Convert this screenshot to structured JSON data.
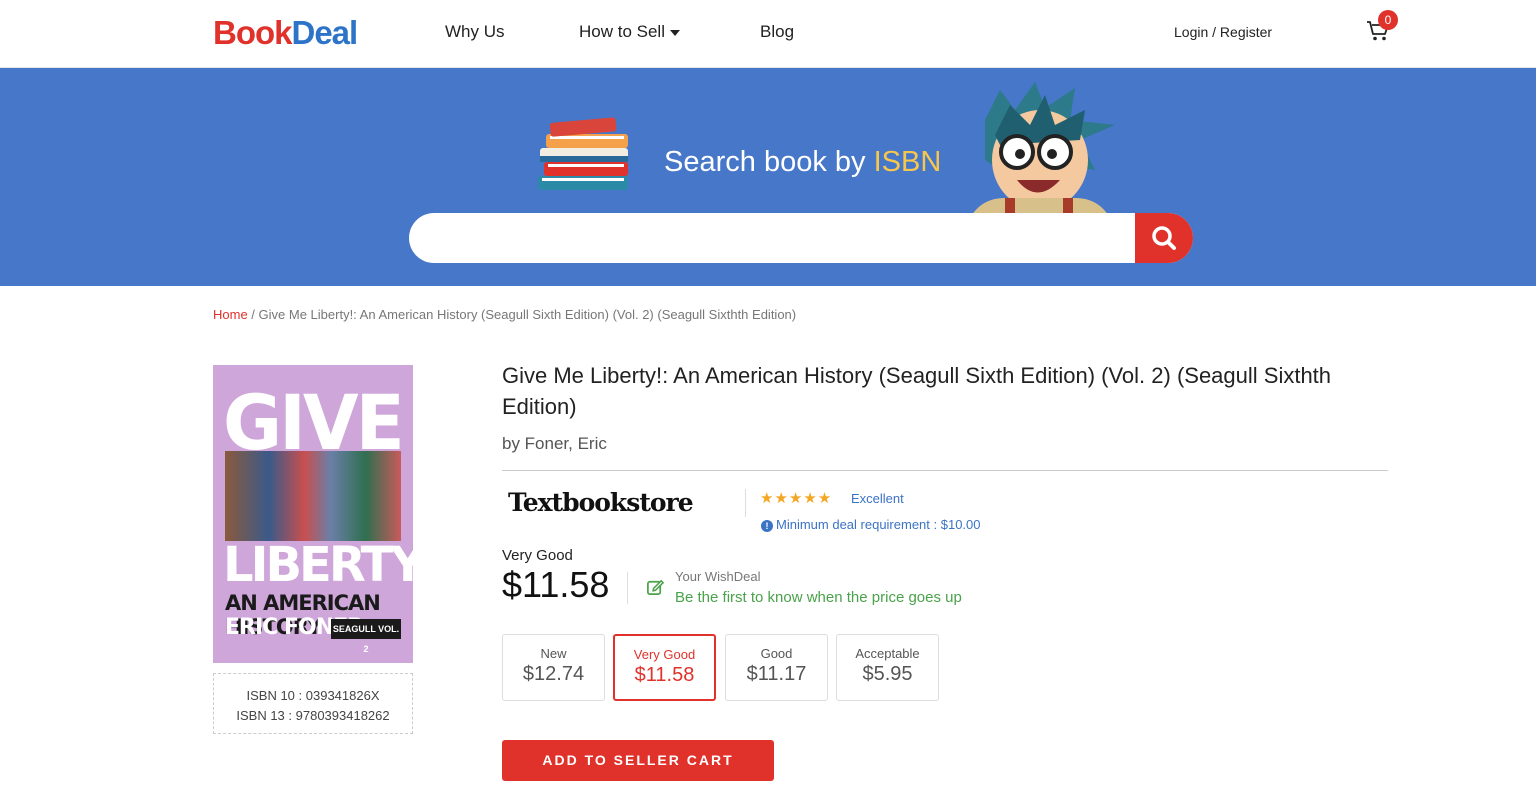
{
  "header": {
    "logo_part1": "Book",
    "logo_part2": "Deal",
    "nav": [
      "Why Us",
      "How to Sell",
      "Blog"
    ],
    "login": "Login / Register",
    "cart_count": "0"
  },
  "hero": {
    "title_part1": "Search book by ",
    "title_part2": "ISBN",
    "search_value": "",
    "search_placeholder": ""
  },
  "breadcrumb": {
    "home": "Home",
    "separator": " / ",
    "current": "Give Me Liberty!: An American History (Seagull Sixth Edition) (Vol. 2) (Seagull Sixthth Edition)"
  },
  "cover": {
    "line1": "GIVE",
    "line2": "LIBERTY!",
    "line3": "AN AMERICAN HISTORY",
    "line4": "ERIC FONER",
    "badge": "SEAGULL VOL. 2"
  },
  "book": {
    "title": "Give Me Liberty!: An American History (Seagull Sixth Edition) (Vol. 2) (Seagull Sixthth Edition)",
    "author": "by Foner, Eric",
    "isbn10": "ISBN 10 : 039341826X",
    "isbn13": "ISBN 13 : 9780393418262"
  },
  "seller": {
    "name": "Textbookstore",
    "stars": "★★★★★",
    "rating_label": "Excellent",
    "min_deal": "Minimum deal requirement : $10.00"
  },
  "pricing": {
    "condition": "Very Good",
    "price": "$11.58",
    "wish_label": "Your WishDeal",
    "wish_text": "Be the first to know when the price goes up"
  },
  "options": [
    {
      "name": "New",
      "price": "$12.74"
    },
    {
      "name": "Very Good",
      "price": "$11.58"
    },
    {
      "name": "Good",
      "price": "$11.17"
    },
    {
      "name": "Acceptable",
      "price": "$5.95"
    }
  ],
  "add_button": "ADD TO SELLER CART",
  "colors": {
    "brand_red": "#e0322b",
    "brand_blue": "#4777c9",
    "accent_yellow": "#f7c64d",
    "link_blue": "#3b73c5",
    "wish_green": "#4aa24a"
  },
  "icons": [
    "cart-icon",
    "search-icon",
    "info-icon",
    "edit-icon",
    "star-icon",
    "chevron-down-icon"
  ]
}
